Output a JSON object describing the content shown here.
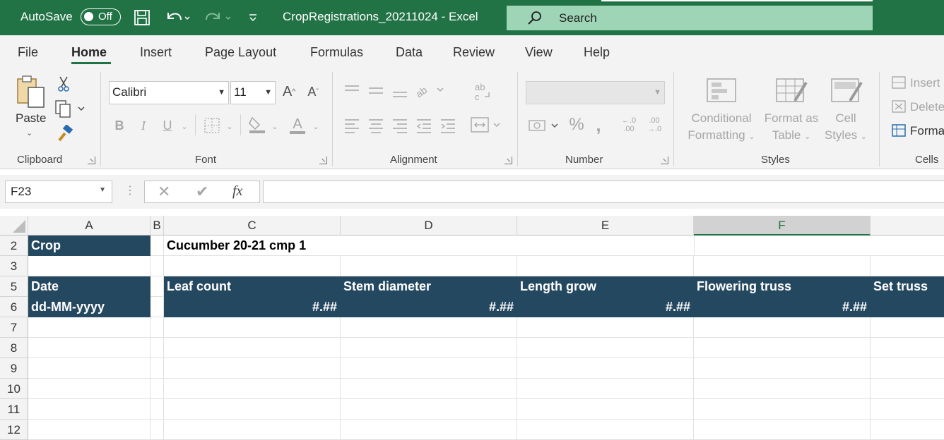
{
  "titlebar": {
    "autosave_label": "AutoSave",
    "toggle_state": "Off",
    "document_title": "CropRegistrations_20211024  -  Excel",
    "search_placeholder": "Search"
  },
  "tabs": [
    "File",
    "Home",
    "Insert",
    "Page Layout",
    "Formulas",
    "Data",
    "Review",
    "View",
    "Help"
  ],
  "ribbon": {
    "clipboard": {
      "paste_label": "Paste",
      "group_label": "Clipboard"
    },
    "font": {
      "font_name": "Calibri",
      "font_size": "11",
      "group_label": "Font"
    },
    "alignment": {
      "group_label": "Alignment"
    },
    "number": {
      "format": "",
      "group_label": "Number"
    },
    "styles": {
      "conditional_formatting": "Conditional\nFormatting",
      "format_as_table": "Format as\nTable",
      "cell_styles": "Cell\nStyles",
      "group_label": "Styles"
    },
    "cells": {
      "insert": "Insert",
      "delete": "Delete",
      "format": "Format",
      "group_label": "Cells"
    }
  },
  "formula_bar": {
    "name_box": "F23",
    "formula": ""
  },
  "sheet": {
    "columns": [
      "A",
      "B",
      "C",
      "D",
      "E",
      "F"
    ],
    "rows": [
      "2",
      "3",
      "5",
      "6",
      "7",
      "8",
      "9",
      "10",
      "11",
      "12"
    ],
    "selected_column": "F",
    "cells": {
      "A2": "Crop",
      "C2": "Cucumber 20-21 cmp 1",
      "A5": "Date",
      "C5": "Leaf count",
      "D5": "Stem diameter",
      "E5": "Length grow",
      "F5": "Flowering truss",
      "G5": "Set truss",
      "A6": "dd-MM-yyyy",
      "C6": "#.##",
      "D6": "#.##",
      "E6": "#.##",
      "F6": "#.##"
    },
    "header_fill": "#254861"
  }
}
